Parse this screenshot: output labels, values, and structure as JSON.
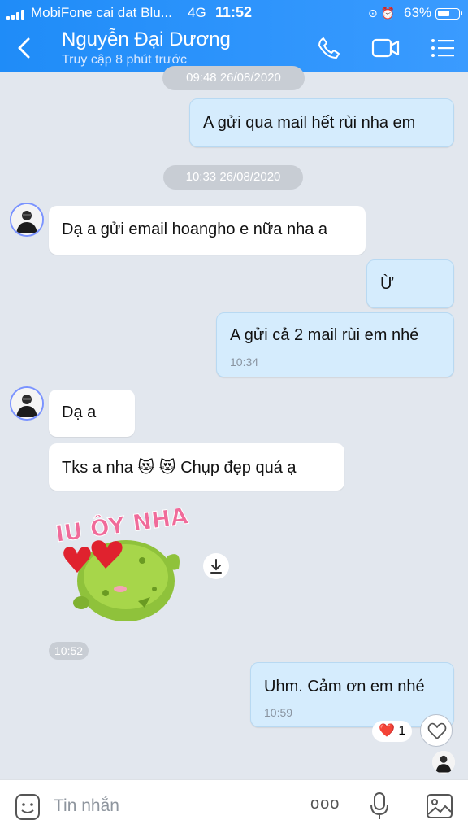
{
  "status_bar": {
    "carrier": "MobiFone cai dat Blu...",
    "network": "4G",
    "time": "11:52",
    "battery_level": "63%",
    "battery_fraction": 0.63
  },
  "header": {
    "contact_name": "Nguyễn Đại Dương",
    "last_seen": "Truy cập 8 phút trước",
    "back_icon": "chevron-left-icon",
    "call_icon": "phone-icon",
    "video_icon": "video-icon",
    "menu_icon": "menu-icon"
  },
  "messages": {
    "ts_1": "09:48 26/08/2020",
    "msg_1": "A gửi qua mail hết rùi nha em",
    "ts_2": "10:33 26/08/2020",
    "msg_2": "Dạ a gửi email hoangho e nữa nha a",
    "msg_3": "Ừ",
    "msg_4": "A gửi cả 2 mail rùi em nhé",
    "msg_4_time": "10:34",
    "msg_5": "Dạ a",
    "msg_6": "Tks a nha 😻 😻 Chụp đẹp quá ạ",
    "sticker_text": "IU ÔY NHA",
    "sticker_time": "10:52",
    "msg_7": "Uhm. Cảm ơn em nhé",
    "msg_7_time": "10:59",
    "reaction_emoji": "❤️",
    "reaction_count": "1"
  },
  "input_bar": {
    "placeholder": "Tin nhắn",
    "more_label": "ooo"
  },
  "colors": {
    "header": "#2a93fb",
    "outgoing_bubble": "#d5ecfd",
    "incoming_bubble": "#ffffff",
    "chat_bg": "#e2e7ee"
  }
}
